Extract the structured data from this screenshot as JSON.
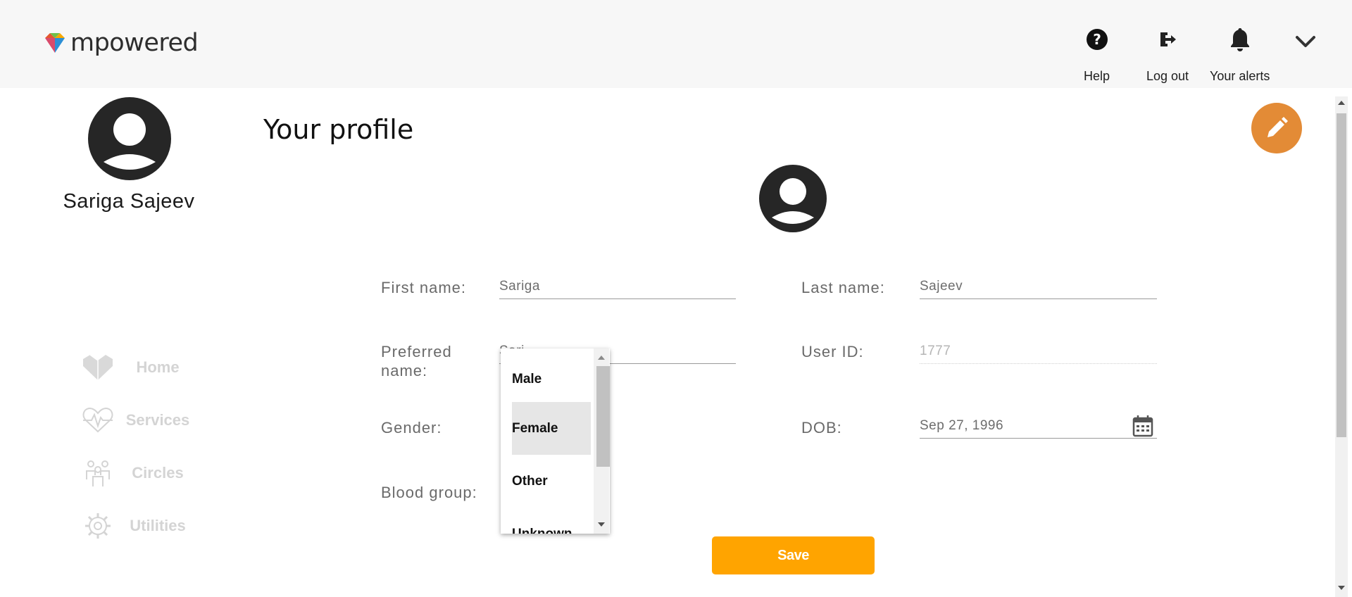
{
  "brand": {
    "name": "mpowered"
  },
  "header": {
    "help_label": "Help",
    "logout_label": "Log out",
    "alerts_label": "Your alerts"
  },
  "sidebar": {
    "user_name": "Sariga Sajeev",
    "items": [
      {
        "label": "Home",
        "icon": "home-heart-icon"
      },
      {
        "label": "Services",
        "icon": "heartbeat-icon"
      },
      {
        "label": "Circles",
        "icon": "people-icon"
      },
      {
        "label": "Utilities",
        "icon": "gear-icon"
      }
    ]
  },
  "main": {
    "title": "Your profile",
    "form": {
      "first_name_label": "First name:",
      "first_name_value": "Sariga",
      "last_name_label": "Last name:",
      "last_name_value": "Sajeev",
      "preferred_name_label": "Preferred name:",
      "preferred_name_value": "Sari",
      "user_id_label": "User ID:",
      "user_id_value": "1777",
      "gender_label": "Gender:",
      "dob_label": "DOB:",
      "dob_value": "Sep 27, 1996",
      "blood_group_label": "Blood group:"
    },
    "gender_dropdown": {
      "options": [
        "Male",
        "Female",
        "Other",
        "Unknown"
      ],
      "highlighted": "Female"
    },
    "save_label": "Save"
  },
  "colors": {
    "header_bg": "#f7f7f7",
    "edit_button": "#e38b36",
    "save_button": "#ffa400",
    "nav_text": "#d4d4d4"
  }
}
